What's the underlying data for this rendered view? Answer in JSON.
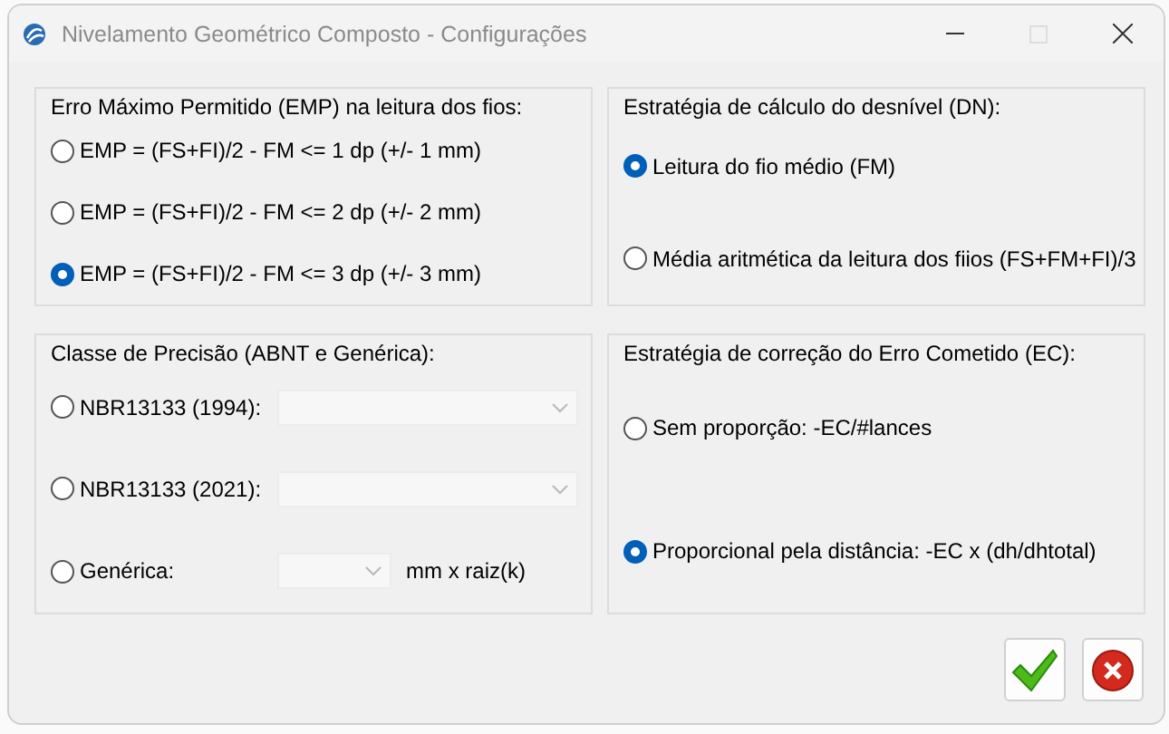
{
  "window": {
    "title": "Nivelamento Geométrico Composto - Configurações"
  },
  "groups": [
    {
      "title": "Erro Máximo Permitido (EMP) na leitura dos fios:",
      "options": [
        {
          "kind": "radio",
          "label": "EMP = (FS+FI)/2 - FM <= 1 dp (+/- 1 mm)",
          "selected": false
        },
        {
          "kind": "radio",
          "label": "EMP = (FS+FI)/2 - FM <= 2 dp (+/- 2 mm)",
          "selected": false
        },
        {
          "kind": "radio",
          "label": "EMP = (FS+FI)/2 - FM <= 3 dp (+/- 3 mm)",
          "selected": true
        }
      ]
    },
    {
      "title": "Estratégia de cálculo do desnível (DN):",
      "options": [
        {
          "kind": "radio",
          "label": "Leitura do fio médio (FM)",
          "selected": true
        },
        {
          "kind": "radio",
          "label": "Média aritmética da leitura dos fiios (FS+FM+FI)/3",
          "selected": false
        }
      ]
    },
    {
      "title": "Classe de Precisão (ABNT e Genérica):",
      "options": [
        {
          "kind": "combo",
          "label": "NBR13133 (1994):",
          "selected": false
        },
        {
          "kind": "combo",
          "label": "NBR13133 (2021):",
          "selected": false
        },
        {
          "kind": "short-combo",
          "label": "Genérica:",
          "selected": false,
          "unit": "mm x raiz(k)"
        }
      ]
    },
    {
      "title": "Estratégia de correção do Erro Cometido (EC):",
      "options": [
        {
          "kind": "radio",
          "label": "Sem proporção: -EC/#lances",
          "selected": false
        },
        {
          "kind": "radio",
          "label": "Proporcional pela distância: -EC x (dh/dhtotal)",
          "selected": true
        }
      ]
    }
  ]
}
